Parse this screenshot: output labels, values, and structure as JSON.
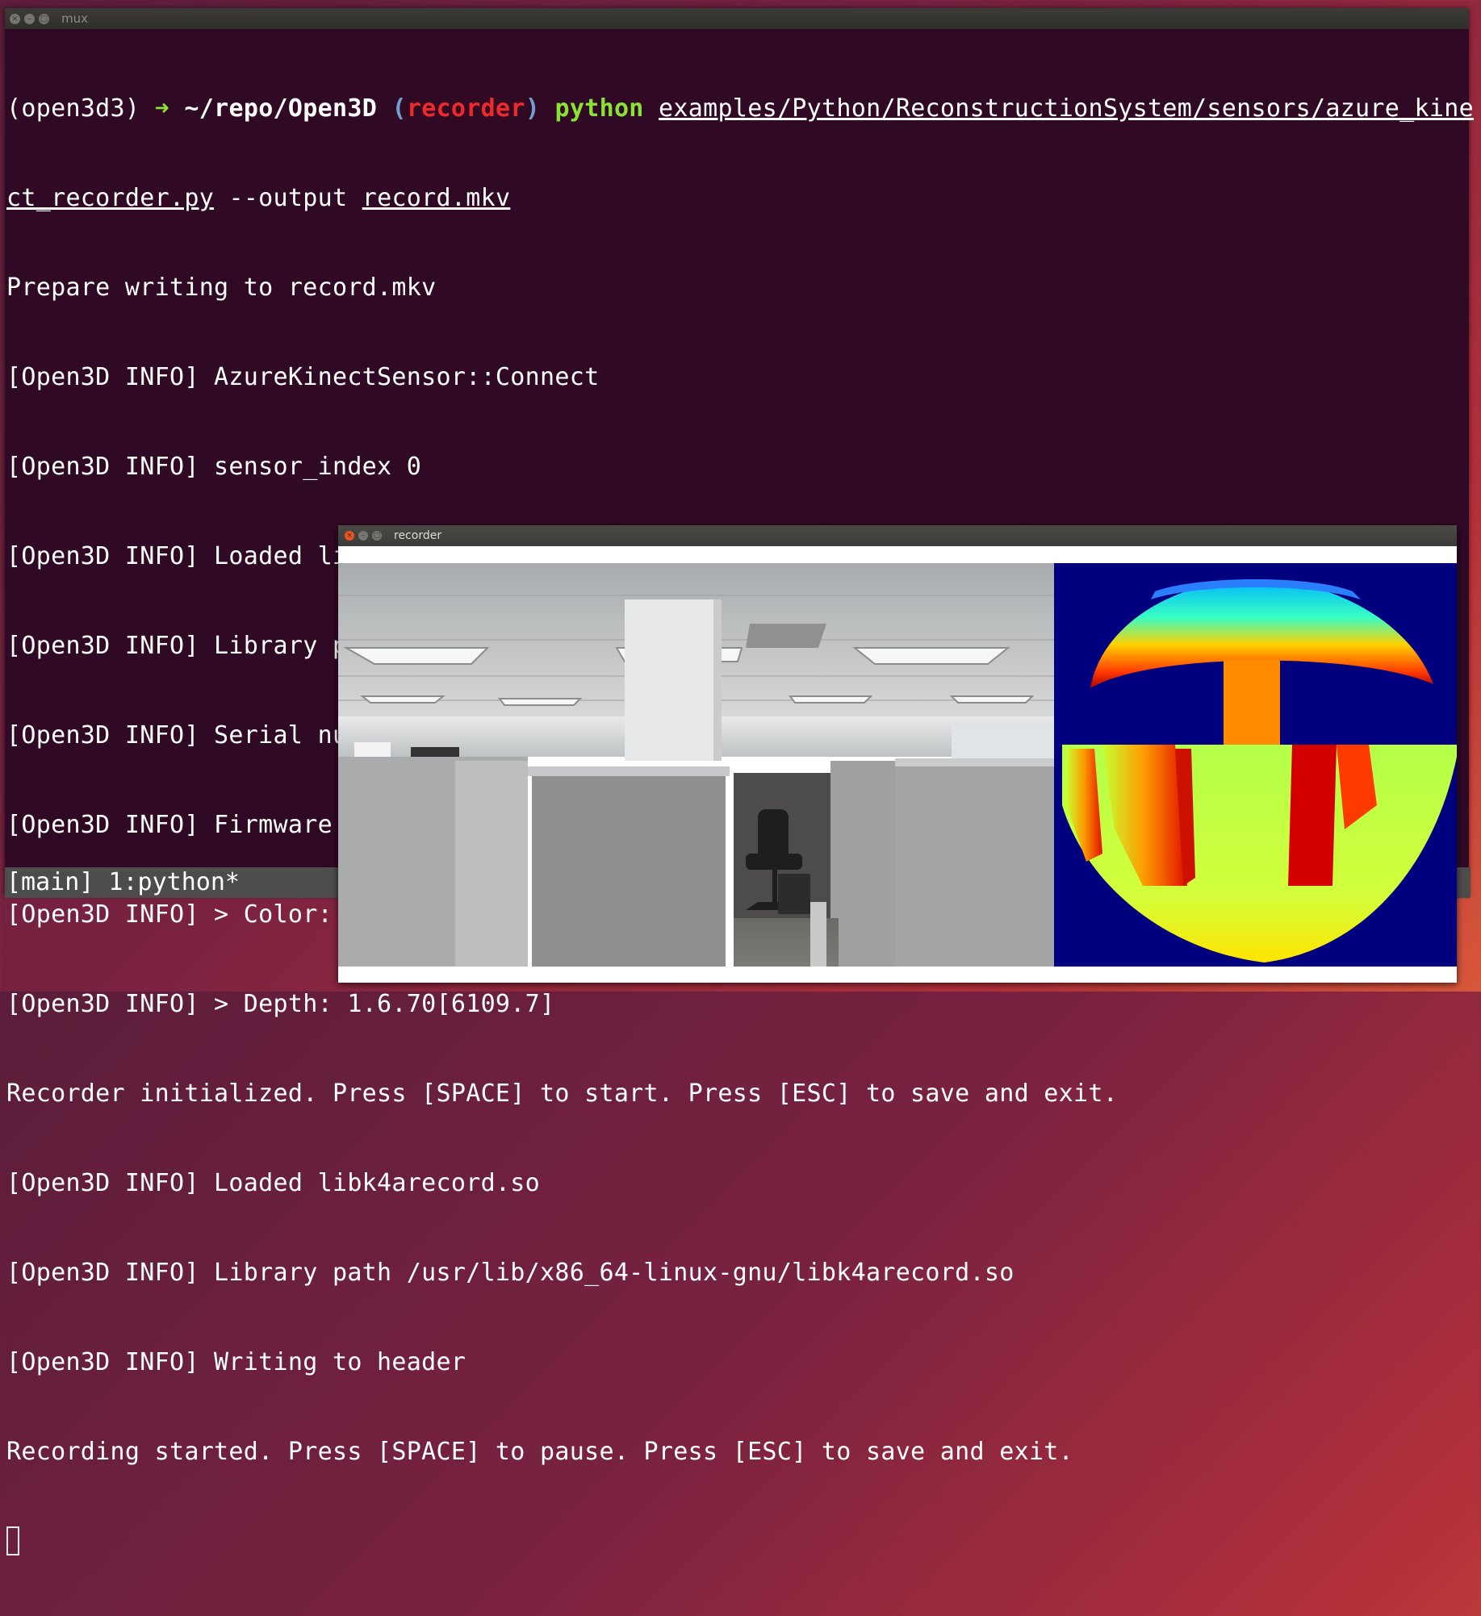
{
  "terminal": {
    "title": "mux",
    "prompt": {
      "env": "(open3d3)",
      "arrow": "➜",
      "path": "~/repo/Open3D",
      "branch_open": "(",
      "branch": "recorder",
      "branch_close": ")",
      "command": "python",
      "script_part1": "examples/Python/ReconstructionSystem/sensors/azure_kine",
      "script_part2": "ct_recorder.py",
      "flag": "--output",
      "output_file": "record.mkv"
    },
    "lines": [
      "Prepare writing to record.mkv",
      "[Open3D INFO] AzureKinectSensor::Connect",
      "[Open3D INFO] sensor_index 0",
      "[Open3D INFO] Loaded libk4a.so",
      "[Open3D INFO] Library path /usr/lib/x86_64-linux-gnu/libk4a.so",
      "[Open3D INFO] Serial number: 000250792212",
      "[Open3D INFO] Firmware build: Rel",
      "[Open3D INFO] > Color: 1.6.98",
      "[Open3D INFO] > Depth: 1.6.70[6109.7]",
      "Recorder initialized. Press [SPACE] to start. Press [ESC] to save and exit.",
      "[Open3D INFO] Loaded libk4arecord.so",
      "[Open3D INFO] Library path /usr/lib/x86_64-linux-gnu/libk4arecord.so",
      "[Open3D INFO] Writing to header",
      "Recording started. Press [SPACE] to pause. Press [ESC] to save and exit."
    ],
    "status_bar": "[main] 1:python*"
  },
  "recorder": {
    "title": "recorder"
  },
  "colors": {
    "terminal_bg": "#300a24",
    "prompt_green": "#8ae234",
    "branch_red": "#ef2929",
    "paren_blue": "#729fcf"
  },
  "icons": [
    "close-icon",
    "minimize-icon",
    "maximize-icon"
  ]
}
